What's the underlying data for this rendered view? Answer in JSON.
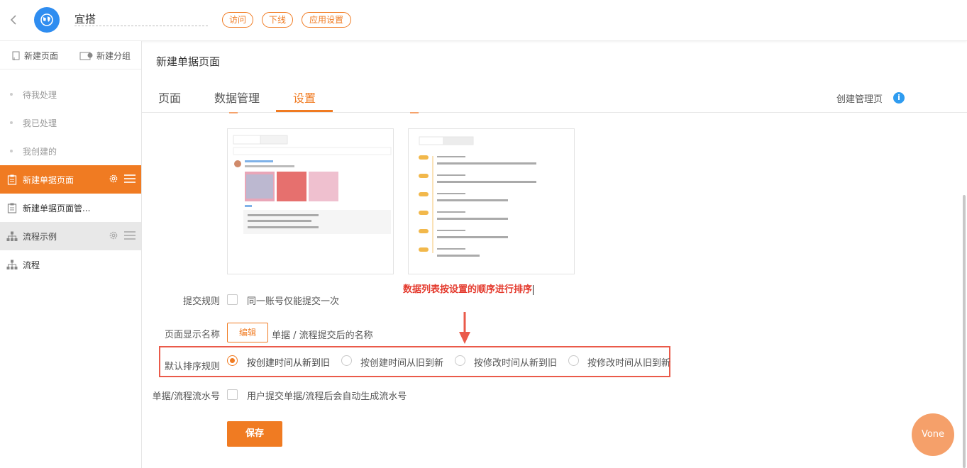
{
  "header": {
    "app_name": "宜搭",
    "pills": [
      "访问",
      "下线",
      "应用设置"
    ]
  },
  "sidebar": {
    "actions": [
      "新建页面",
      "新建分组"
    ],
    "items": [
      {
        "label": "待我处理"
      },
      {
        "label": "我已处理"
      },
      {
        "label": "我创建的"
      },
      {
        "label": "新建单据页面"
      },
      {
        "label": "新建单据页面管..."
      },
      {
        "label": "流程示例"
      },
      {
        "label": "流程"
      }
    ]
  },
  "main": {
    "title": "新建单据页面",
    "tabs": [
      "页面",
      "数据管理",
      "设置"
    ],
    "active_tab": "设置",
    "manage_link": "创建管理页",
    "sort_caption": "数据列表按设置的顺序进行排序",
    "form": {
      "submit_rule_label": "提交规则",
      "submit_rule_option": "同一账号仅能提交一次",
      "display_name_label": "页面显示名称",
      "edit_button": "编辑",
      "display_name_hint": "单据 / 流程提交后的名称",
      "sort_label": "默认排序规则",
      "sort_options": [
        "按创建时间从新到旧",
        "按创建时间从旧到新",
        "按修改时间从新到旧",
        "按修改时间从旧到新"
      ],
      "sort_selected": "按创建时间从新到旧",
      "serial_label": "单据/流程流水号",
      "serial_option": "用户提交单据/流程后会自动生成流水号"
    },
    "save_button": "保存"
  },
  "floating": {
    "label": "Vone"
  },
  "colors": {
    "accent": "#f07b22",
    "highlight": "#ea5a4a",
    "caption": "#e4392c",
    "logo": "#2f8df0"
  }
}
